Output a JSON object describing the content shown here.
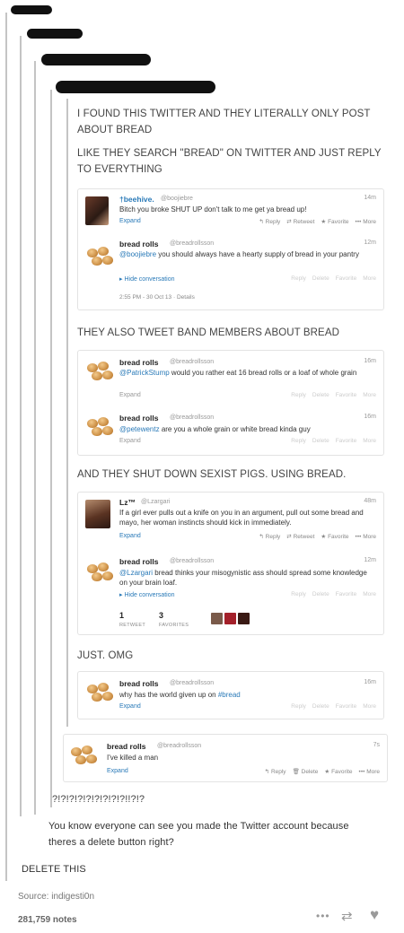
{
  "intro_lines": [
    "I FOUND THIS TWITTER AND THEY LITERALLY ONLY POST ABOUT BREAD",
    "LIKE THEY SEARCH \"BREAD\" ON TWITTER AND JUST REPLY TO EVERYTHING"
  ],
  "section_labels": {
    "band": "THEY ALSO TWEET BAND MEMBERS ABOUT BREAD",
    "sexist": "AND THEY SHUT DOWN SEXIST PIGS. USING BREAD.",
    "omg": "JUST. OMG",
    "question": "?!?!?!?!?!?!?!?!?!!?!?"
  },
  "reply_text": "You know everyone can see you made the Twitter account because theres a delete button right?",
  "delete_this": "DELETE THIS",
  "source": "Source: indigesti0n",
  "notes": "281,759 notes",
  "actions": {
    "reply": "Reply",
    "retweet": "Retweet",
    "delete": "Delete",
    "favorite": "Favorite",
    "more": "More",
    "expand": "Expand",
    "hide": "Hide conversation",
    "details": "Details"
  },
  "tweets": {
    "t1": {
      "name": "†beehive.",
      "handle": "@boojiebre",
      "time": "14m",
      "text": "Bitch you broke SHUT UP don't talk to me get ya bread up!"
    },
    "t2": {
      "name": "bread rolls",
      "handle": "@breadrollsson",
      "time": "12m",
      "mention": "@boojiebre",
      "text": " you should always have a hearty supply of bread in your pantry",
      "timestamp": "2:55 PM - 30 Oct 13"
    },
    "t3": {
      "name": "bread rolls",
      "handle": "@breadrollsson",
      "time": "16m",
      "mention": "@PatrickStump",
      "text": " would you rather eat 16 bread rolls or a loaf of whole grain"
    },
    "t4": {
      "name": "bread rolls",
      "handle": "@breadrollsson",
      "time": "16m",
      "mention": "@petewentz",
      "text": " are you a whole grain or white bread kinda guy"
    },
    "t5": {
      "name": "Lz™",
      "handle": "@Lzargari",
      "time": "48m",
      "text": "If a girl ever pulls out a knife on you in an argument, pull out some bread and mayo, her woman instincts should kick in immediately."
    },
    "t6": {
      "name": "bread rolls",
      "handle": "@breadrollsson",
      "time": "12m",
      "mention": "@Lzargari",
      "text": " bread thinks your misogynistic ass should spread some knowledge on your brain loaf.",
      "retweets": "1",
      "retweets_label": "RETWEET",
      "favorites": "3",
      "favorites_label": "FAVORITES"
    },
    "t7": {
      "name": "bread rolls",
      "handle": "@breadrollsson",
      "time": "16m",
      "text": "why has the world given up on ",
      "hashtag": "#bread"
    },
    "t8": {
      "name": "bread rolls",
      "handle": "@breadrollsson",
      "time": "7s",
      "text": "I've killed a man"
    }
  }
}
